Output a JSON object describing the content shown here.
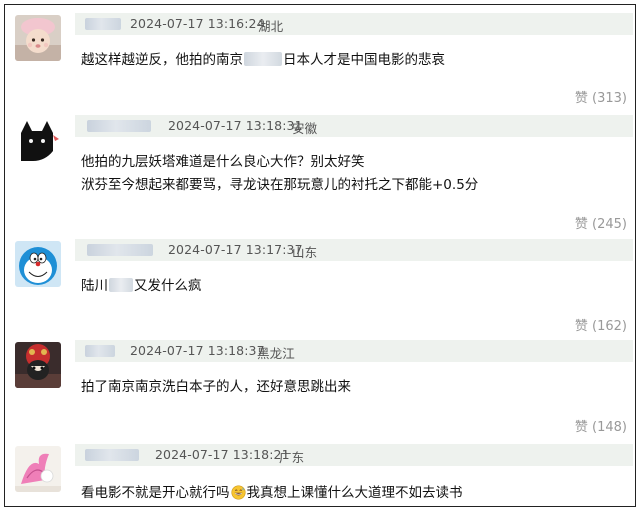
{
  "comments": [
    {
      "time": "2024-07-17 13:16:24",
      "location": "湖北",
      "lines": [
        {
          "before": "越这样越逆反，他拍的南京",
          "after": "日本人才是中国电影的悲哀"
        }
      ],
      "like_icon": "赞",
      "like_count": "(313)"
    },
    {
      "time": "2024-07-17 13:18:31",
      "location": "安徽",
      "lines": [
        {
          "text": "他拍的九层妖塔难道是什么良心大作？别太好笑"
        },
        {
          "text": "洑芬至今想起来都要骂，寻龙诀在那玩意儿的衬托之下都能+0.5分"
        }
      ],
      "like_icon": "赞",
      "like_count": "(245)"
    },
    {
      "time": "2024-07-17 13:17:37",
      "location": "山东",
      "lines": [
        {
          "before": "陆川",
          "after": "又发什么疯"
        }
      ],
      "like_icon": "赞",
      "like_count": "(162)"
    },
    {
      "time": "2024-07-17 13:18:37",
      "location": "黑龙江",
      "lines": [
        {
          "text": "拍了南京南京洗白本子的人，还好意思跳出来"
        }
      ],
      "like_icon": "赞",
      "like_count": "(148)"
    },
    {
      "time": "2024-07-17 13:18:21",
      "location": "广东",
      "lines": [
        {
          "before": "看电影不就是开心就行吗",
          "after": "我真想上课懂什么大道理不如去读书"
        }
      ]
    }
  ],
  "icons": {
    "avatar_1": "baby-avatar",
    "avatar_2": "black-cat-avatar",
    "avatar_3": "doraemon-avatar",
    "avatar_4": "costume-avatar",
    "avatar_5": "pink-flower-avatar",
    "emoji": "grinning-sweat-emoji"
  },
  "colors": {
    "meta_bg": "#eef2ee",
    "meta_text": "#555555",
    "body_text": "#111111",
    "like_text": "#999999",
    "frame_border": "#222222"
  }
}
